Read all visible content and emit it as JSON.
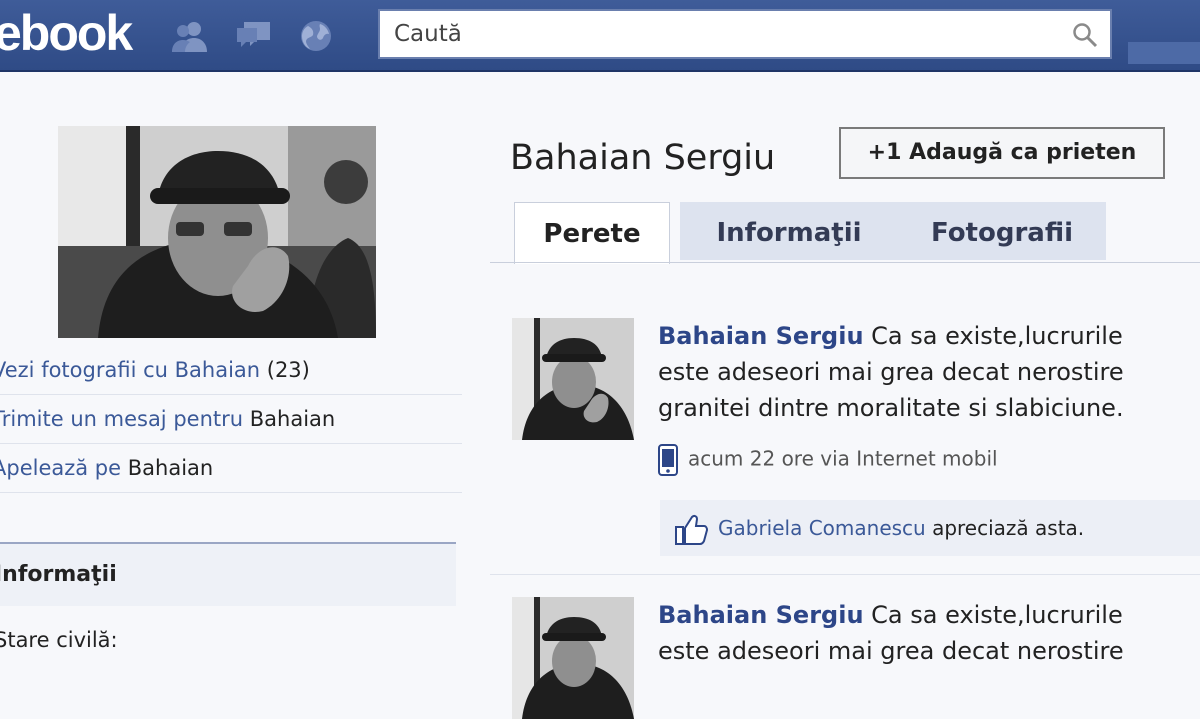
{
  "colors": {
    "brand_blue": "#3b5998",
    "topbar": "#3f5c99",
    "link": "#3b5998",
    "author": "#2d4688"
  },
  "topbar": {
    "logo": "ebook",
    "icons": [
      "friends-icon",
      "messages-icon",
      "notifications-globe-icon"
    ],
    "search": {
      "placeholder": "Caută",
      "icon": "search-icon"
    }
  },
  "sidebar": {
    "links": [
      {
        "prefix": "",
        "link": "Vezi fotografii cu Bahaian",
        "suffix": " (23)"
      },
      {
        "prefix": "",
        "link": "Trimite un mesaj pentru",
        "suffix": " Bahaian"
      },
      {
        "prefix": "",
        "link": "Apelează pe",
        "suffix": " Bahaian"
      }
    ],
    "info_header": "Informaţii",
    "info_row": "Stare civilă:"
  },
  "profile": {
    "name": "Bahaian Sergiu",
    "add_friend_label": "+1 Adaugă ca prieten",
    "tabs": [
      "Perete",
      "Informaţii",
      "Fotografii"
    ]
  },
  "posts": [
    {
      "author": "Bahaian Sergiu",
      "line1": " Ca sa existe,lucrurile",
      "line2": "este adeseori mai grea decat nerostire",
      "line3": "granitei dintre moralitate si slabiciune.",
      "meta": "acum 22 ore via Internet mobil",
      "like_user": "Gabriela Comanescu",
      "like_text": " apreciază asta."
    },
    {
      "author": "Bahaian Sergiu",
      "line1": " Ca sa existe,lucrurile",
      "line2": "este adeseori mai grea decat nerostire"
    }
  ]
}
